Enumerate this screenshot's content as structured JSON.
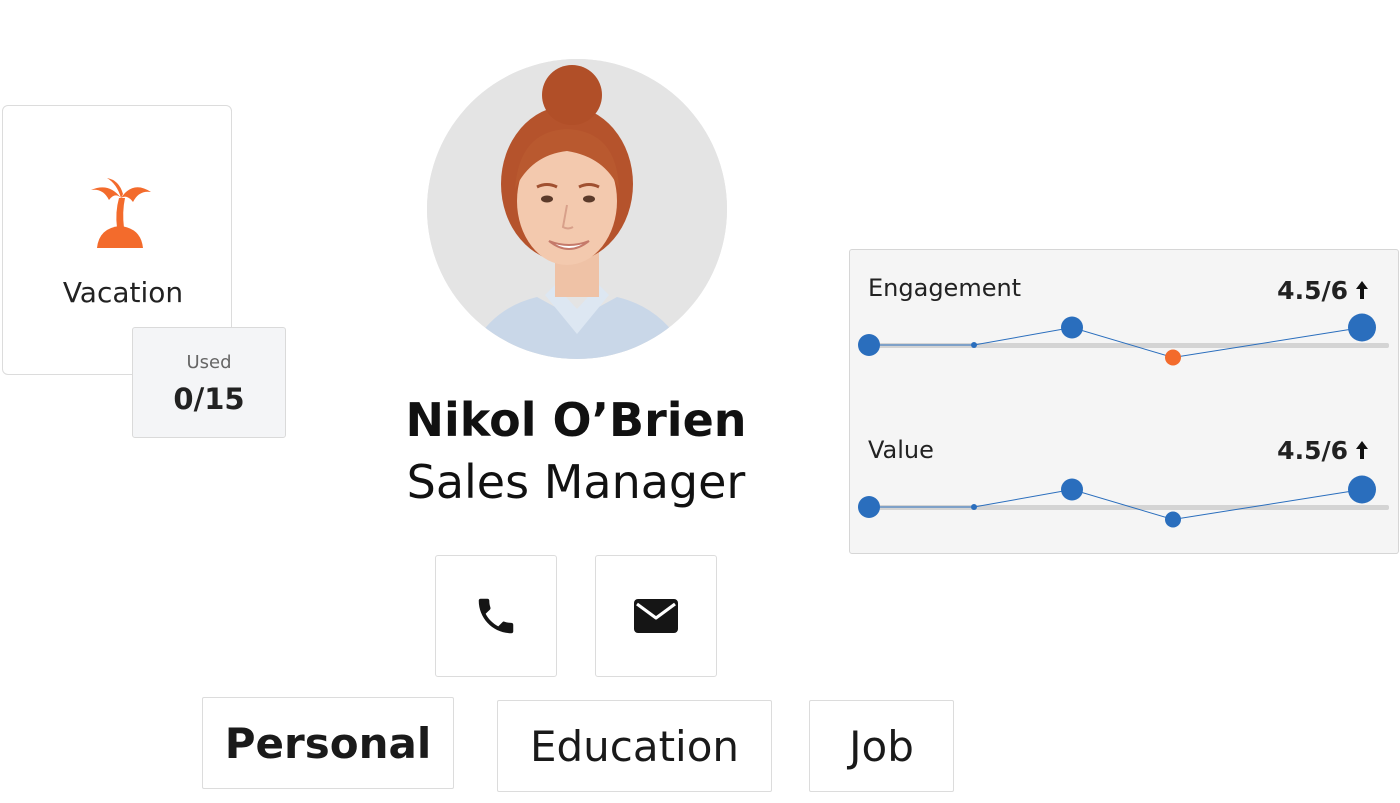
{
  "vacation": {
    "label": "Vacation",
    "used_label": "Used",
    "used_value": "0/15",
    "icon": "palm-tree-icon",
    "icon_color": "#f36b2c"
  },
  "profile": {
    "name": "Nikol O’Brien",
    "role": "Sales Manager"
  },
  "contact": {
    "phone_icon": "phone-icon",
    "mail_icon": "mail-icon"
  },
  "tabs": [
    {
      "label": "Personal",
      "active": true
    },
    {
      "label": "Education",
      "active": false
    },
    {
      "label": "Job",
      "active": false
    }
  ],
  "metrics": [
    {
      "label": "Engagement",
      "score": "4.5/6",
      "trend": "up",
      "points": [
        3.0,
        3.0,
        3.7,
        2.5,
        3.7
      ],
      "highlight_index": 3,
      "highlight_color": "#f36b2c"
    },
    {
      "label": "Value",
      "score": "4.5/6",
      "trend": "up",
      "points": [
        3.0,
        3.0,
        3.7,
        2.5,
        3.7
      ],
      "highlight_index": null,
      "highlight_color": null
    }
  ],
  "colors": {
    "accent_blue": "#2a6ebd",
    "accent_orange": "#f36b2c"
  }
}
